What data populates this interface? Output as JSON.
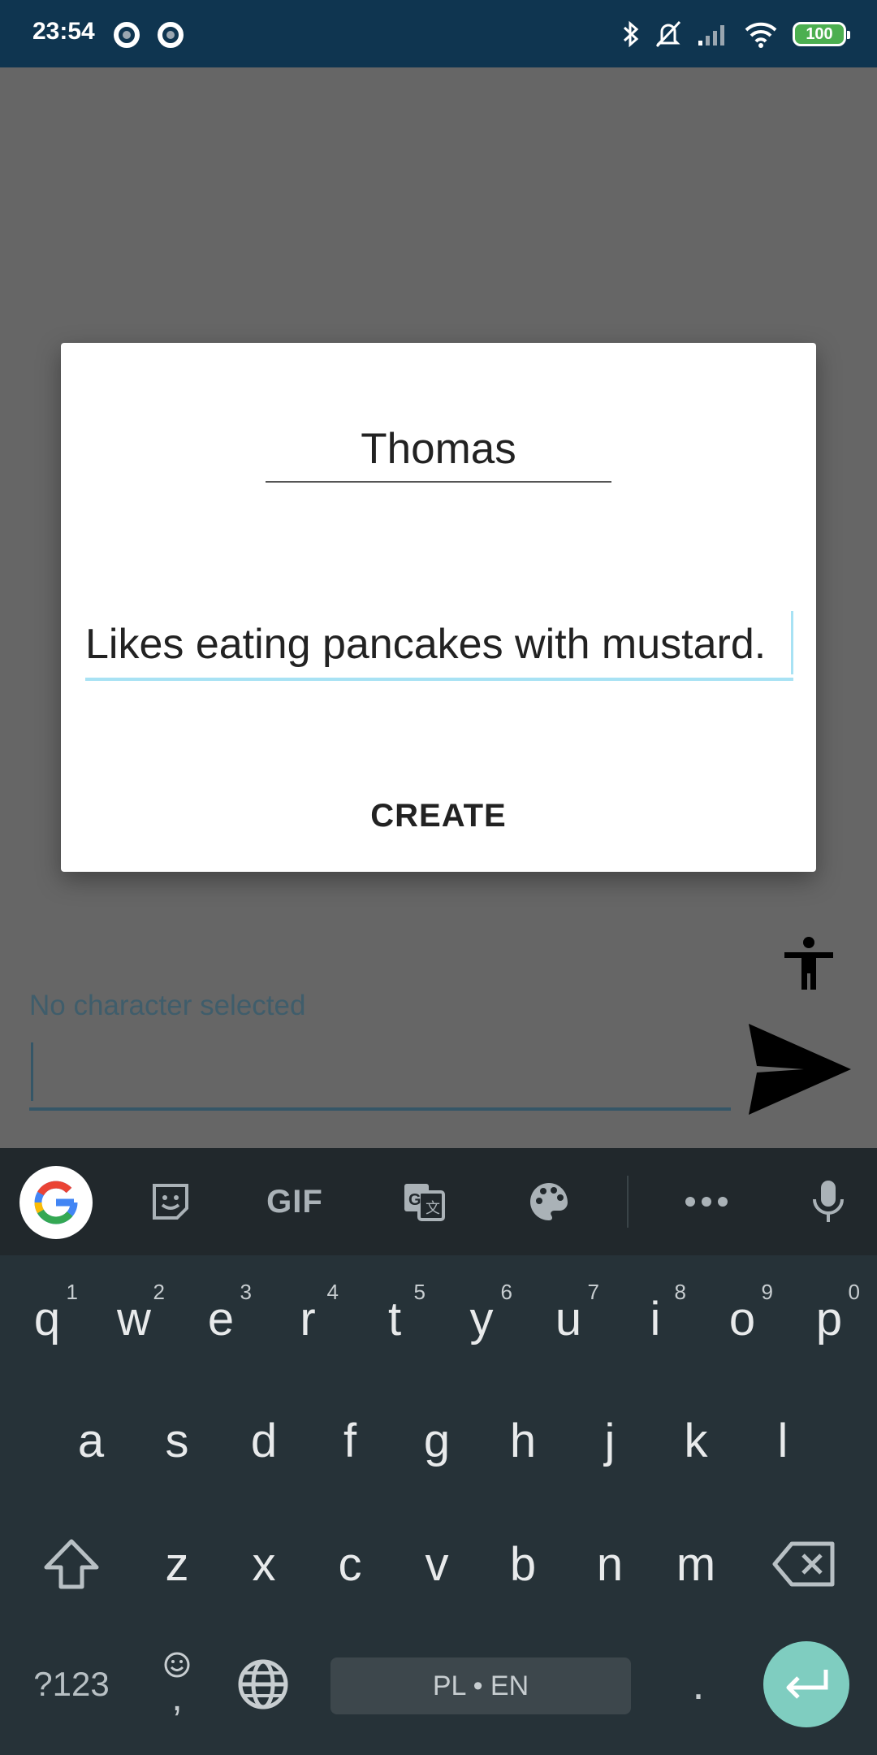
{
  "status_bar": {
    "time": "23:54",
    "battery": "100",
    "icons": [
      "bluetooth-icon",
      "bell-off-icon",
      "signal-icon",
      "wifi-icon",
      "battery-icon"
    ]
  },
  "app": {
    "character_status": "No character selected",
    "message_value": ""
  },
  "dialog": {
    "name_value": "Thomas",
    "description_value": "Likes eating pancakes with mustard.",
    "create_label": "CREATE"
  },
  "keyboard": {
    "toolbar": [
      "google-icon",
      "sticker-icon",
      "GIF",
      "translate-icon",
      "palette-icon",
      "more-icon",
      "mic-icon"
    ],
    "gif_label": "GIF",
    "row1": [
      {
        "key": "q",
        "sup": "1"
      },
      {
        "key": "w",
        "sup": "2"
      },
      {
        "key": "e",
        "sup": "3"
      },
      {
        "key": "r",
        "sup": "4"
      },
      {
        "key": "t",
        "sup": "5"
      },
      {
        "key": "y",
        "sup": "6"
      },
      {
        "key": "u",
        "sup": "7"
      },
      {
        "key": "i",
        "sup": "8"
      },
      {
        "key": "o",
        "sup": "9"
      },
      {
        "key": "p",
        "sup": "0"
      }
    ],
    "row2": [
      "a",
      "s",
      "d",
      "f",
      "g",
      "h",
      "j",
      "k",
      "l"
    ],
    "row3": [
      "z",
      "x",
      "c",
      "v",
      "b",
      "n",
      "m"
    ],
    "symbols_label": "?123",
    "comma_label": ",",
    "space_label": "PL • EN",
    "period_label": "."
  },
  "colors": {
    "status_bar": "#0f3550",
    "scrim": "#666666",
    "keyboard_bg": "#263238",
    "enter_key": "#7fcdc0",
    "input_focus": "#a8e2f4"
  }
}
